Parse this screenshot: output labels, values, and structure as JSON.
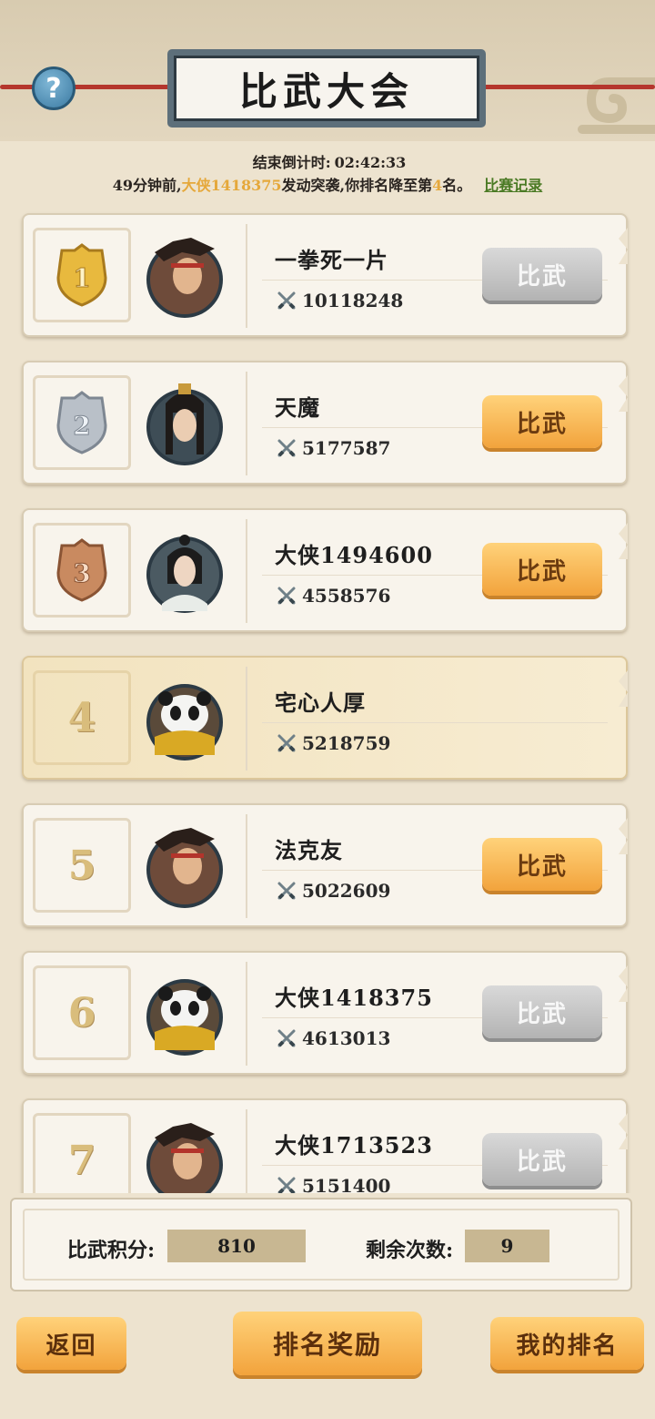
{
  "header": {
    "title": "比武大会",
    "help_icon": "question-icon",
    "countdown_label": "结束倒计时:",
    "countdown_value": "02:42:33",
    "notice": {
      "prefix": "49分钟前,",
      "attacker": "大侠1418375",
      "middle": "发动突袭,你排名降至第",
      "rank": "4",
      "suffix": "名。",
      "record_link": "比赛记录"
    }
  },
  "ranking": [
    {
      "rank": "1",
      "name": "一拳死一片",
      "power": "10118248",
      "button": "比武",
      "button_enabled": false,
      "medal_color": "#e8b93e"
    },
    {
      "rank": "2",
      "name": "天魔",
      "power": "5177587",
      "button": "比武",
      "button_enabled": true,
      "medal_color": "#b9c0c8"
    },
    {
      "rank": "3",
      "name": "大侠1494600",
      "power": "4558576",
      "button": "比武",
      "button_enabled": true,
      "medal_color": "#c98a60"
    },
    {
      "rank": "4",
      "name": "宅心人厚",
      "power": "5218759",
      "is_self": true
    },
    {
      "rank": "5",
      "name": "法克友",
      "power": "5022609",
      "button": "比武",
      "button_enabled": true
    },
    {
      "rank": "6",
      "name": "大侠1418375",
      "power": "4613013",
      "button": "比武",
      "button_enabled": false
    },
    {
      "rank": "7",
      "name": "大侠1713523",
      "power": "5151400",
      "button": "比武",
      "button_enabled": false
    }
  ],
  "footer": {
    "points_label": "比武积分:",
    "points_value": "810",
    "remaining_label": "剩余次数:",
    "remaining_value": "9"
  },
  "bottom_bar": {
    "back": "返回",
    "rewards": "排名奖励",
    "my_rank": "我的排名"
  },
  "colors": {
    "accent": "#f2a33c",
    "highlight": "#e5a83b",
    "link": "#4a7a24",
    "rope": "#b5362d"
  }
}
